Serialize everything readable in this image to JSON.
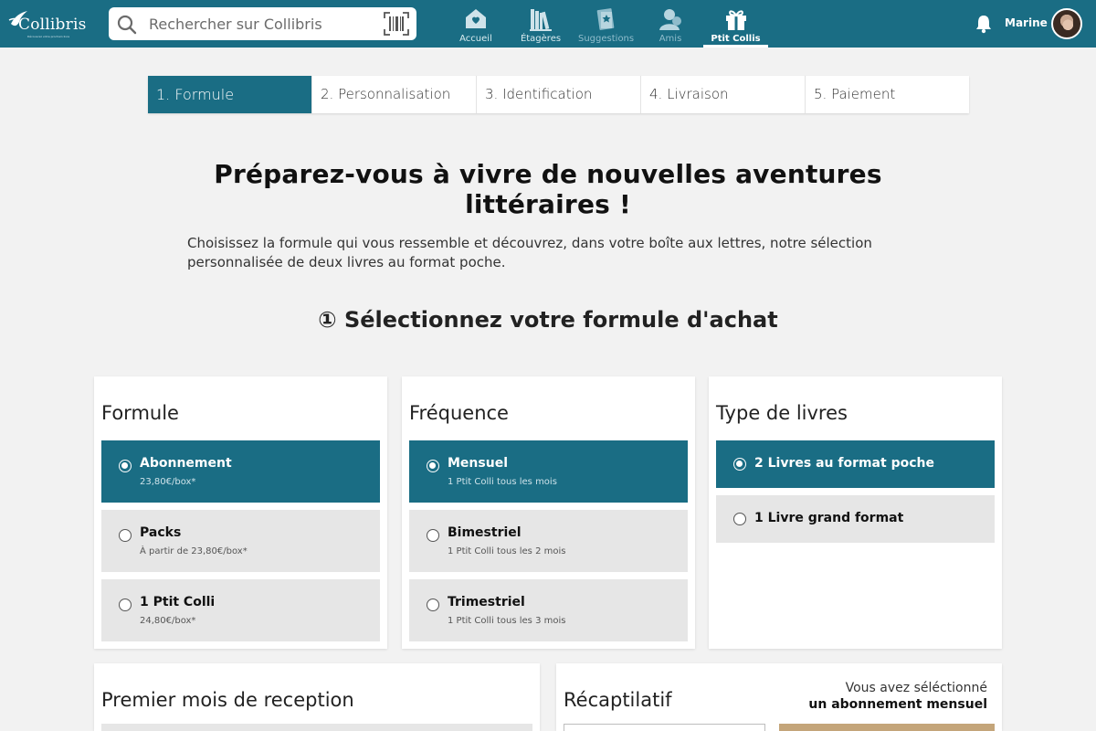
{
  "header": {
    "logo_text": "Collibris",
    "logo_tagline": "Découvrez votre prochain livre",
    "search_placeholder": "Rechercher sur Collibris",
    "nav": [
      {
        "label": "Accueil",
        "icon": "home-icon"
      },
      {
        "label": "Étagères",
        "icon": "bookshelf-icon"
      },
      {
        "label": "Suggestions",
        "icon": "suggestions-icon"
      },
      {
        "label": "Amis",
        "icon": "friends-icon"
      },
      {
        "label": "Ptit Collis",
        "icon": "gift-icon",
        "active": true
      }
    ],
    "user_name": "Marine"
  },
  "steps": [
    {
      "label": "1. Formule",
      "active": true
    },
    {
      "label": "2. Personnalisation"
    },
    {
      "label": "3. Identification"
    },
    {
      "label": "4. Livraison"
    },
    {
      "label": "5. Paiement"
    }
  ],
  "main": {
    "title": "Préparez-vous à vivre de nouvelles aventures littéraires !",
    "intro": "Choisissez la formule qui vous ressemble et découvrez, dans votre boîte aux lettres, notre sélection personnalisée de deux livres au format poche.",
    "section_title": "① Sélectionnez votre formule d'achat"
  },
  "formule": {
    "title": "Formule",
    "options": [
      {
        "title": "Abonnement",
        "sub": "23,80€/box*",
        "selected": true
      },
      {
        "title": "Packs",
        "sub": "À partir de 23,80€/box*"
      },
      {
        "title": "1 Ptit Colli",
        "sub": "24,80€/box*"
      }
    ]
  },
  "frequence": {
    "title": "Fréquence",
    "options": [
      {
        "title": "Mensuel",
        "sub": "1 Ptit Colli tous les mois",
        "selected": true
      },
      {
        "title": "Bimestriel",
        "sub": "1 Ptit Colli tous les 2 mois"
      },
      {
        "title": "Trimestriel",
        "sub": "1 Ptit Colli tous les 3 mois"
      }
    ]
  },
  "type_livres": {
    "title": "Type de livres",
    "options": [
      {
        "title": "2 Livres au format poche",
        "selected": true
      },
      {
        "title": "1 Livre grand format"
      }
    ]
  },
  "premier_mois": {
    "title": "Premier mois de reception"
  },
  "recap": {
    "title": "Récaptilatif",
    "note_line1": "Vous avez séléctionné",
    "note_line2": "un abonnement mensuel"
  },
  "colors": {
    "brand": "#1a6d84",
    "option_bg": "#e6e6e6",
    "page_bg": "#f2f2f2",
    "accent_gold": "#c4a57a"
  }
}
